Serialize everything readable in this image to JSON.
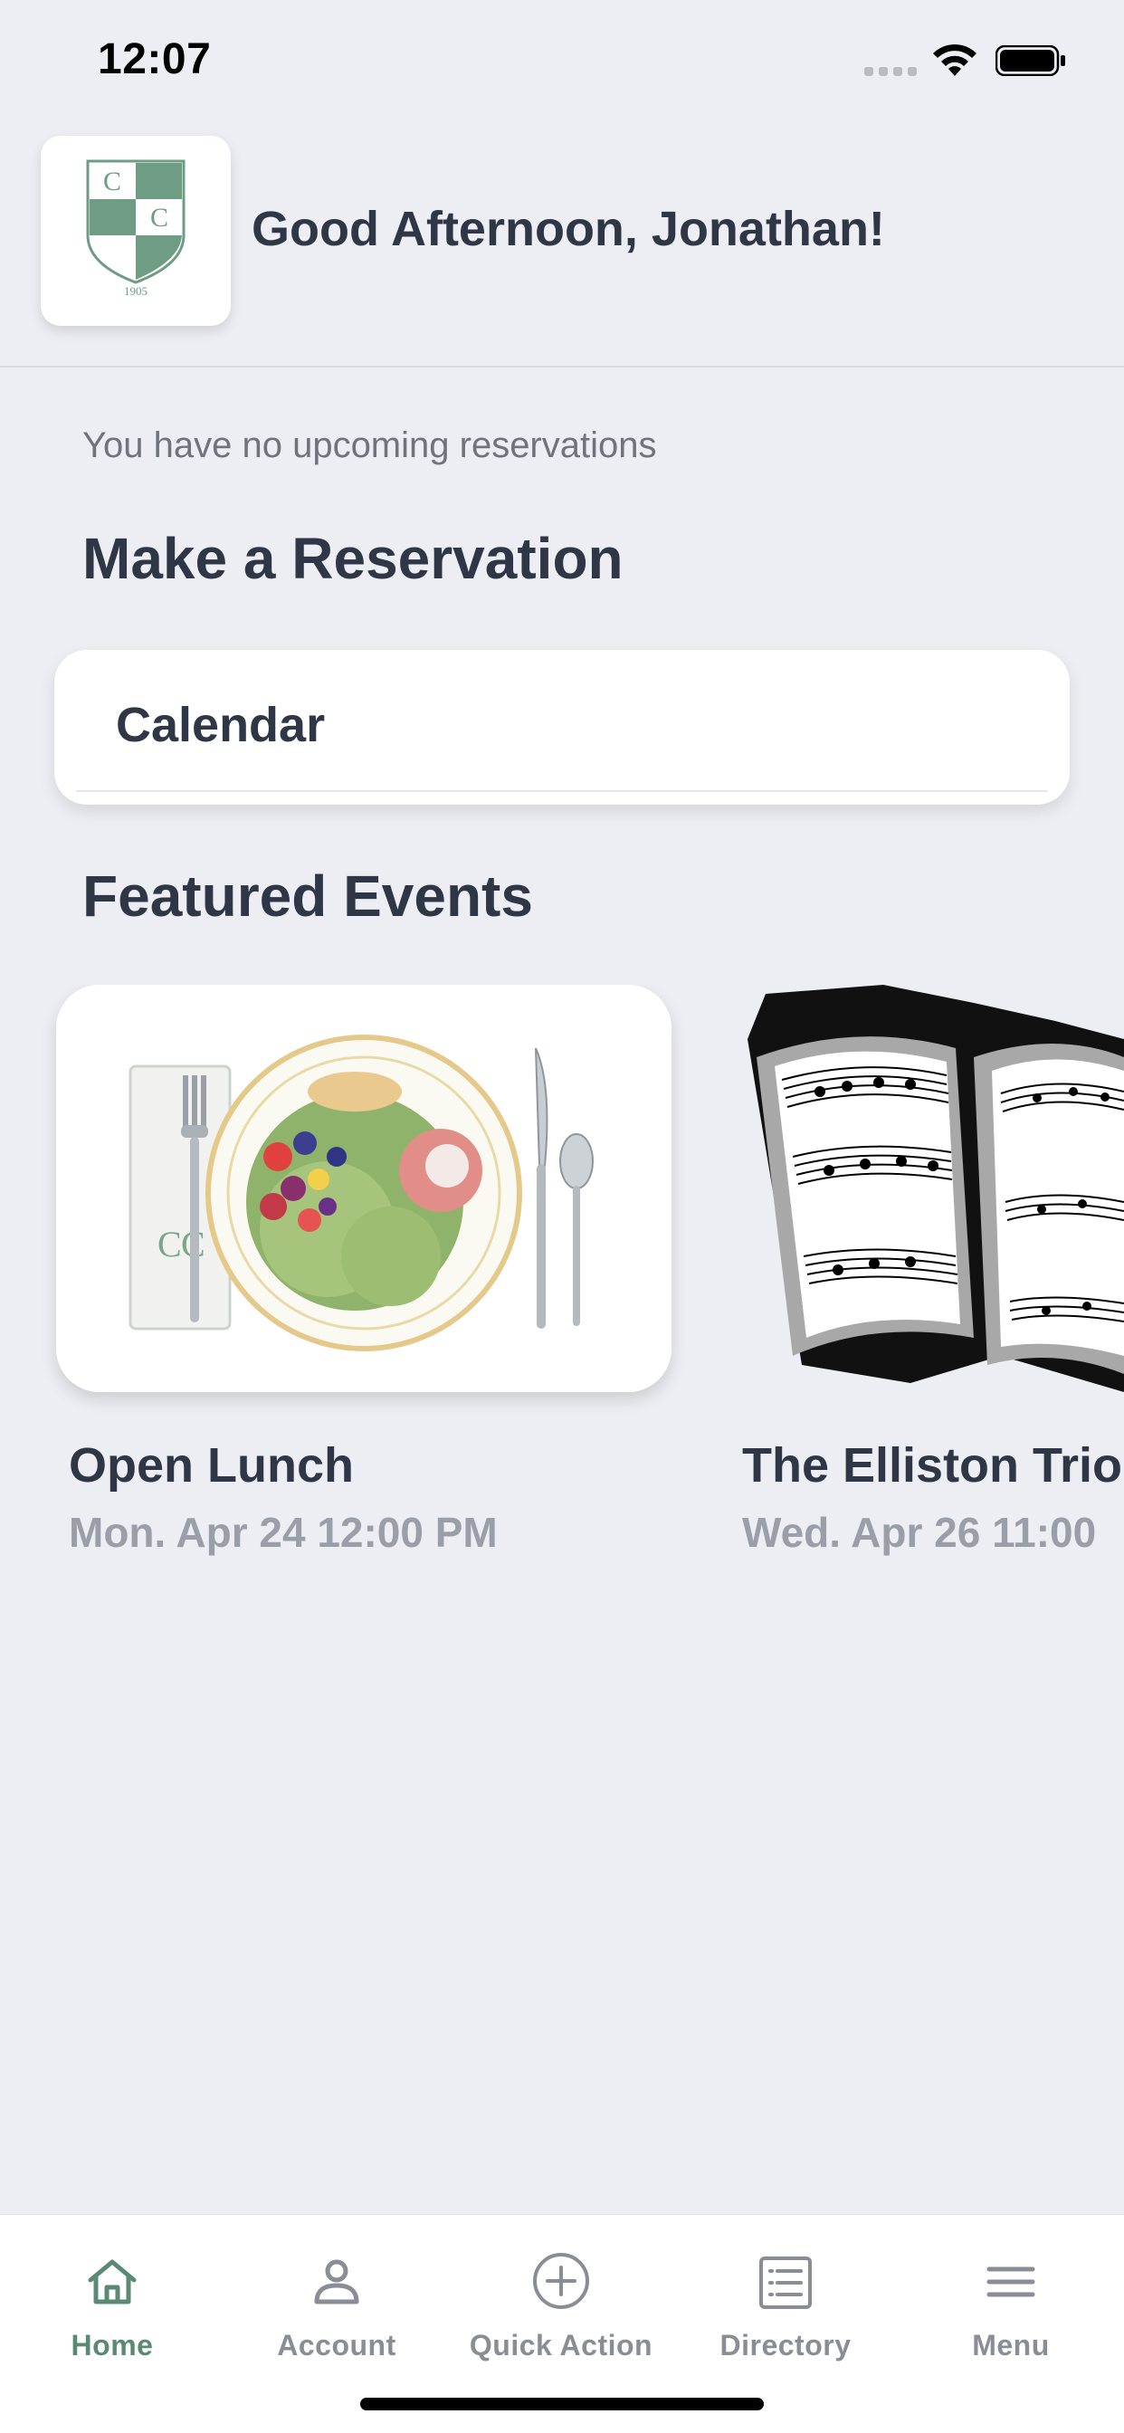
{
  "status_bar": {
    "time": "12:07",
    "signal_icon": "cellular-signal-icon",
    "wifi_icon": "wifi-icon",
    "battery_icon": "battery-icon"
  },
  "header": {
    "logo_icon": "club-crest-logo",
    "logo_year": "1905",
    "greeting": "Good Afternoon, Jonathan!"
  },
  "reservations": {
    "empty_message": "You have no upcoming reservations",
    "section_title": "Make a Reservation",
    "calendar_label": "Calendar"
  },
  "featured": {
    "section_title": "Featured Events",
    "events": [
      {
        "title": "Open Lunch",
        "date": "Mon. Apr 24 12:00 PM",
        "image_icon": "lunch-plate-illustration"
      },
      {
        "title": "The Elliston Trio",
        "date": "Wed. Apr 26 11:00",
        "image_icon": "sheet-music-illustration"
      }
    ]
  },
  "tab_bar": {
    "active_color": "#5b8a74",
    "inactive_color": "#8a8d95",
    "tabs": [
      {
        "label": "Home",
        "icon": "home-icon",
        "active": true
      },
      {
        "label": "Account",
        "icon": "person-icon",
        "active": false
      },
      {
        "label": "Quick Action",
        "icon": "plus-circle-icon",
        "active": false
      },
      {
        "label": "Directory",
        "icon": "list-document-icon",
        "active": false
      },
      {
        "label": "Menu",
        "icon": "hamburger-menu-icon",
        "active": false
      }
    ]
  }
}
